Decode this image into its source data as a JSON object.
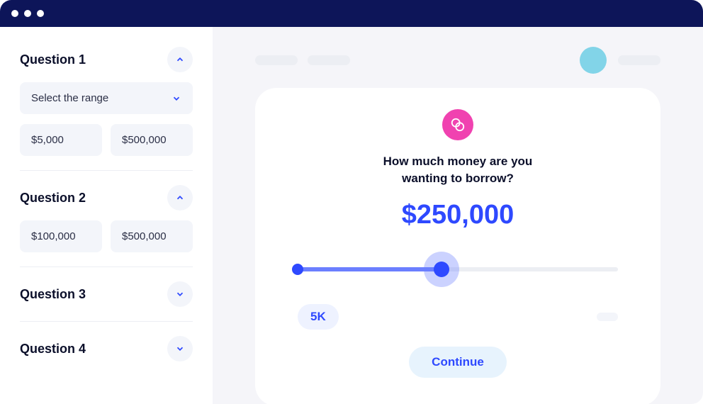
{
  "sidebar": {
    "questions": [
      {
        "title": "Question 1",
        "expanded": true,
        "select_label": "Select the range",
        "min": "$5,000",
        "max": "$500,000"
      },
      {
        "title": "Question 2",
        "expanded": true,
        "min": "$100,000",
        "max": "$500,000"
      },
      {
        "title": "Question 3",
        "expanded": false
      },
      {
        "title": "Question 4",
        "expanded": false
      }
    ]
  },
  "main": {
    "question_text": "How much money are you wanting to borrow?",
    "amount": "$250,000",
    "min_label": "5K",
    "continue_label": "Continue"
  },
  "colors": {
    "brand_blue": "#2e49ff",
    "pink": "#f042b0",
    "avatar": "#82d4e8",
    "header": "#0d1559"
  }
}
